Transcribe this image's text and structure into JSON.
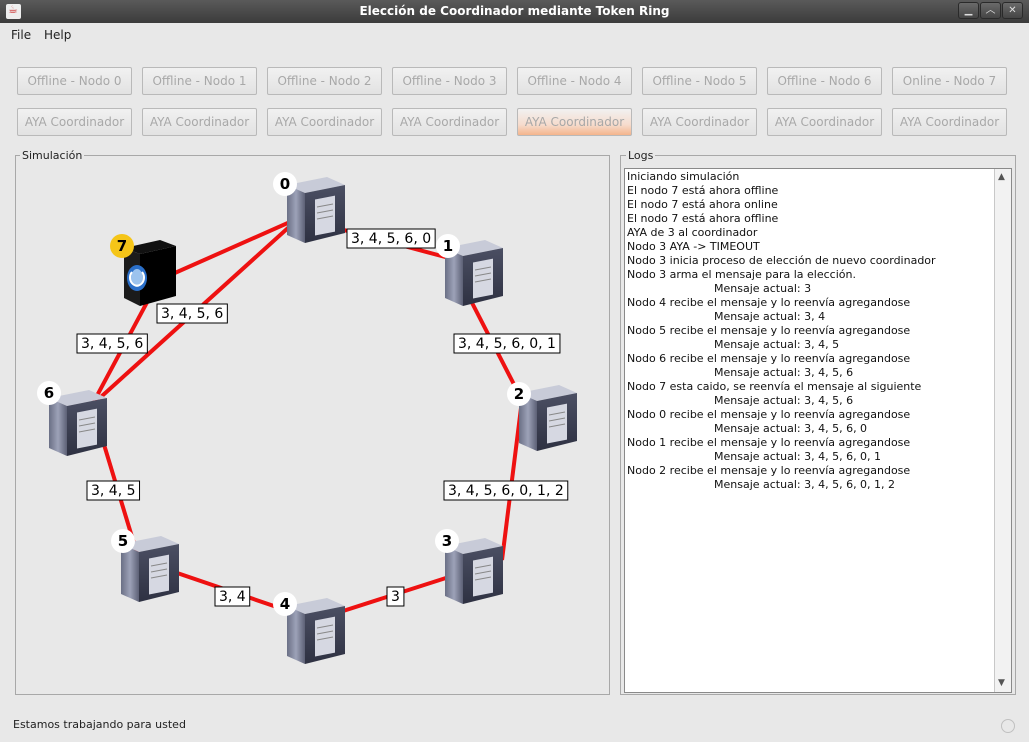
{
  "window": {
    "title": "Elección de Coordinador mediante Token Ring"
  },
  "menu": [
    "File",
    "Help"
  ],
  "node_buttons": [
    "Offline - Nodo 0",
    "Offline - Nodo 1",
    "Offline - Nodo 2",
    "Offline - Nodo 3",
    "Offline - Nodo 4",
    "Offline - Nodo 5",
    "Offline - Nodo 6",
    "Online - Nodo 7"
  ],
  "aya_buttons": [
    "AYA Coordinador",
    "AYA Coordinador",
    "AYA Coordinador",
    "AYA Coordinador",
    "AYA Coordinador",
    "AYA Coordinador",
    "AYA Coordinador",
    "AYA Coordinador"
  ],
  "aya_highlighted_index": 4,
  "simulation": {
    "title": "Simulación",
    "nodes": [
      {
        "id": "0",
        "status": "online"
      },
      {
        "id": "1",
        "status": "online"
      },
      {
        "id": "2",
        "status": "online"
      },
      {
        "id": "3",
        "status": "online"
      },
      {
        "id": "4",
        "status": "online"
      },
      {
        "id": "5",
        "status": "online"
      },
      {
        "id": "6",
        "status": "online"
      },
      {
        "id": "7",
        "status": "offline-coordinator"
      }
    ],
    "edge_labels": [
      "3, 4, 5, 6, 0",
      "3, 4, 5, 6, 0, 1",
      "3, 4, 5, 6, 0, 1, 2",
      "3",
      "3, 4",
      "3, 4, 5",
      "3, 4, 5, 6",
      "3, 4, 5, 6"
    ],
    "link_color": "#ee1111",
    "coordinator_badge_color": "#f5c518"
  },
  "logs": {
    "title": "Logs",
    "lines": [
      "Iniciando simulación",
      "El nodo 7 está ahora offline",
      "El nodo 7 está ahora online",
      "El nodo 7 está ahora offline",
      "AYA de 3 al coordinador",
      "Nodo 3 AYA -> TIMEOUT",
      "Nodo 3 inicia proceso de elección de nuevo coordinador",
      "Nodo 3 arma el mensaje para la elección.",
      "Mensaje actual: 3",
      "Nodo 4 recibe el mensaje y lo reenvía agregandose",
      "Mensaje actual: 3, 4",
      "Nodo 5 recibe el mensaje y lo reenvía agregandose",
      "Mensaje actual: 3, 4, 5",
      "Nodo 6 recibe el mensaje y lo reenvía agregandose",
      "Mensaje actual: 3, 4, 5, 6",
      "Nodo 7 esta caido, se reenvía el mensaje al siguiente",
      "Mensaje actual: 3, 4, 5, 6",
      "Nodo 0 recibe el mensaje y lo reenvía agregandose",
      "Mensaje actual: 3, 4, 5, 6, 0",
      "Nodo 1 recibe el mensaje y lo reenvía agregandose",
      "Mensaje actual: 3, 4, 5, 6, 0, 1",
      "Nodo 2 recibe el mensaje y lo reenvía agregandose",
      "Mensaje actual: 3, 4, 5, 6, 0, 1, 2"
    ]
  },
  "status_bar": {
    "text": "Estamos trabajando para usted"
  }
}
